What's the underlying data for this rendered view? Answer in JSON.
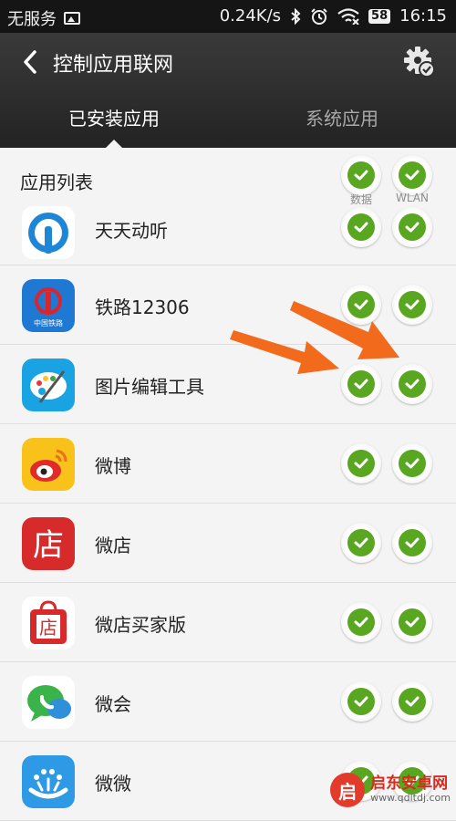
{
  "status_bar": {
    "carrier": "无服务",
    "speed": "0.24K/s",
    "battery": "58",
    "time": "16:15"
  },
  "header": {
    "title": "控制应用联网",
    "tabs": [
      {
        "label": "已安装应用",
        "active": true
      },
      {
        "label": "系统应用",
        "active": false
      }
    ]
  },
  "list": {
    "title": "应用列表",
    "col_data_label": "数据",
    "col_wlan_label": "WLAN",
    "apps": [
      {
        "name": "天天动听",
        "data": true,
        "wlan": true
      },
      {
        "name": "铁路12306",
        "icon_text": "中国铁路",
        "data": true,
        "wlan": true
      },
      {
        "name": "图片编辑工具",
        "data": true,
        "wlan": true
      },
      {
        "name": "微博",
        "data": true,
        "wlan": true
      },
      {
        "name": "微店",
        "icon_text": "店",
        "data": true,
        "wlan": true
      },
      {
        "name": "微店买家版",
        "icon_text": "店",
        "data": true,
        "wlan": true
      },
      {
        "name": "微会",
        "data": true,
        "wlan": true
      },
      {
        "name": "微微",
        "data": true,
        "wlan": true
      }
    ]
  },
  "watermark": {
    "logo_text": "启",
    "title": "启东安卓网",
    "url": "www.qdltdj.com"
  },
  "colors": {
    "check_green": "#59a621",
    "arrow_orange": "#f26a1b",
    "header_bg": "#2d2d2d"
  }
}
